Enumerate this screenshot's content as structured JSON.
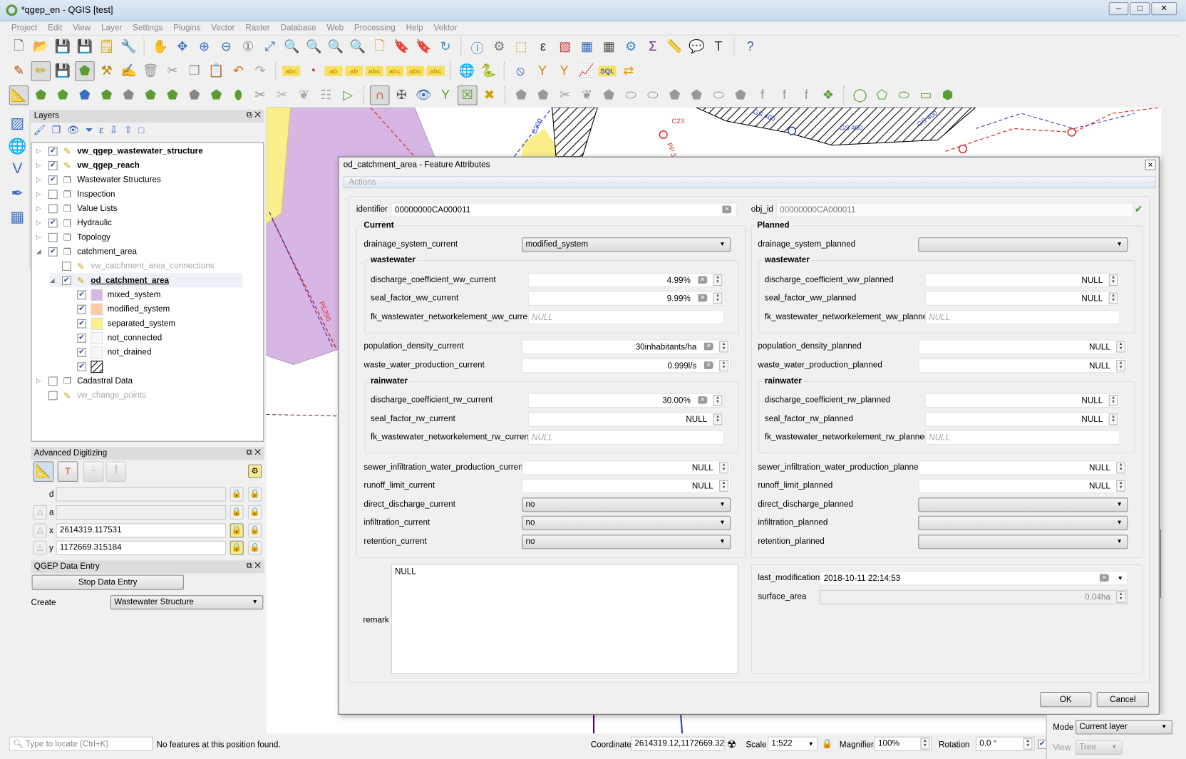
{
  "window": {
    "title": "*qgep_en - QGIS [test]",
    "controls": [
      "–",
      "□",
      "✕"
    ]
  },
  "menu": [
    "Project",
    "Edit",
    "View",
    "Layer",
    "Settings",
    "Plugins",
    "Vector",
    "Raster",
    "Database",
    "Web",
    "Processing",
    "Help",
    "Vektor"
  ],
  "toolbars": {
    "row1": [
      [
        "new-project-icon",
        "🗋",
        "#555"
      ],
      [
        "open-project-icon",
        "📂",
        "#e0b030"
      ],
      [
        "save-project-icon",
        "💾",
        "#46628a"
      ],
      [
        "save-as-icon",
        "💾",
        "#46628a"
      ],
      [
        "new-print-layout-icon",
        "🗒",
        "#c9a000"
      ],
      [
        "layout-manager-icon",
        "🔧",
        "#777"
      ],
      "|",
      [
        "pan-icon",
        "✋",
        "#333"
      ],
      [
        "pan-to-selection-icon",
        "✥",
        "#3a6fc0"
      ],
      [
        "zoom-in-icon",
        "⊕",
        "#3a6fc0"
      ],
      [
        "zoom-out-icon",
        "⊖",
        "#3a6fc0"
      ],
      [
        "zoom-native-icon",
        "①",
        "#777"
      ],
      [
        "zoom-full-icon",
        "⤢",
        "#3a6fc0"
      ],
      [
        "zoom-selection-icon",
        "🔍",
        "#c9a000"
      ],
      [
        "zoom-layer-icon",
        "🔍",
        "#777"
      ],
      [
        "zoom-last-icon",
        "🔍",
        "#3a6fc0"
      ],
      [
        "zoom-next-icon",
        "🔍",
        "#aaa"
      ],
      [
        "new-bookmark-icon",
        "🗋",
        "#c9a000"
      ],
      [
        "show-bookmarks-icon",
        "🔖",
        "#c9a000"
      ],
      [
        "temporal-icon",
        "🔖",
        "#777"
      ],
      [
        "refresh-icon",
        "↻",
        "#3a8ad0"
      ],
      "|",
      [
        "identify-icon",
        "ⓘ",
        "#3a6fc0"
      ],
      [
        "action-icon",
        "⚙",
        "#777"
      ],
      [
        "select-icon",
        "⬚",
        "#c9a000"
      ],
      [
        "select-value-icon",
        "ε",
        "#333"
      ],
      [
        "deselect-icon",
        "▧",
        "#d04040"
      ],
      [
        "attribute-table-icon",
        "▦",
        "#3a6fc0"
      ],
      [
        "field-calc-icon",
        "▦",
        "#555"
      ],
      [
        "toolbox-icon",
        "⚙",
        "#3a8ad0"
      ],
      [
        "statistics-icon",
        "Σ",
        "#6a2aa0"
      ],
      [
        "measure-icon",
        "📏",
        "#555"
      ],
      [
        "map-tips-icon",
        "💬",
        "#e0c000"
      ],
      [
        "text-annotation-icon",
        "T",
        "#333"
      ],
      "|",
      [
        "help-icon",
        "?",
        "#3a5fa0"
      ]
    ],
    "row2": [
      [
        "current-edits-icon",
        "✎",
        "#c04000"
      ],
      [
        "toggle-editing-icon",
        "✏",
        "#d0a000"
      ],
      [
        "save-edits-icon",
        "💾",
        "#46628a"
      ],
      [
        "add-feature-icon",
        "⬟",
        "#5a9e33"
      ],
      [
        "vertex-tool-icon",
        "⚒",
        "#c08000"
      ],
      [
        "modify-attributes-icon",
        "✍",
        "#999"
      ],
      [
        "delete-selected-icon",
        "🗑",
        "#999"
      ],
      [
        "cut-icon",
        "✂",
        "#999"
      ],
      [
        "copy-icon",
        "❐",
        "#999"
      ],
      [
        "paste-icon",
        "📋",
        "#999"
      ],
      [
        "undo-icon",
        "↶",
        "#e07020"
      ],
      [
        "redo-icon",
        "↷",
        "#aaa"
      ],
      "|",
      [
        "label-icon",
        "abc",
        "#c9a000"
      ],
      [
        "diagram-icon",
        "◔",
        "#d03030"
      ],
      [
        "pin-label-icon",
        "ab",
        "#c9a000"
      ],
      [
        "highlight-pin-icon",
        "ab",
        "#c9a000"
      ],
      [
        "show-hide-label-icon",
        "abc",
        "#c9a000"
      ],
      [
        "move-label-icon",
        "abc",
        "#c9a000"
      ],
      [
        "rotate-label-icon",
        "abc",
        "#c9a000"
      ],
      [
        "change-label-icon",
        "abc",
        "#c9a000"
      ],
      "|",
      [
        "qgep-globe-icon",
        "🌐",
        "#345"
      ],
      [
        "python-icon",
        "🐍",
        "#3a6fc0"
      ],
      "|",
      [
        "qgep-connect-icon",
        "⦸",
        "#3a6fc0"
      ],
      [
        "upstream-icon",
        "Y",
        "#e08000"
      ],
      [
        "downstream-icon",
        "Y",
        "#e08000"
      ],
      [
        "profile-icon",
        "📈",
        "#3a5fa0"
      ],
      [
        "sql-icon",
        "SQL",
        "#3a5fa0"
      ],
      [
        "wizard-icon",
        "⇄",
        "#e0a000"
      ]
    ],
    "row3": [
      [
        "advanced-digitizing-icon",
        "📐",
        "#e07020"
      ],
      [
        "add-ring-icon",
        "⬟",
        "#5a9e33"
      ],
      [
        "rotate-feature-icon",
        "⬟",
        "#5a9e33"
      ],
      [
        "reshape-icon",
        "⬟",
        "#3a6fc0"
      ],
      [
        "add-part-icon",
        "⬟",
        "#5a9e33"
      ],
      [
        "fill-ring-icon",
        "⬟",
        "#888"
      ],
      [
        "add-ring2-icon",
        "⬟",
        "#5a9e33"
      ],
      [
        "delete-ring-icon",
        "⬟",
        "#5a9e33"
      ],
      [
        "delete-part-icon",
        "⬟",
        "#888"
      ],
      [
        "reshape-features-icon",
        "⬟",
        "#5a9e33"
      ],
      [
        "offset-curve-icon",
        "⬮",
        "#5a9e33"
      ],
      [
        "split-features-icon",
        "✂",
        "#888"
      ],
      [
        "split-parts-icon",
        "✂",
        "#aaa"
      ],
      [
        "merge-selected-icon",
        "❦",
        "#aaa"
      ],
      [
        "merge-attributes-icon",
        "☷",
        "#aaa"
      ],
      [
        "rotate-symbols-icon",
        "▷",
        "#5a9e33"
      ],
      "|",
      [
        "snapping-icon",
        "∩",
        "#d02020"
      ],
      [
        "topological-editing-icon",
        "✠",
        "#666"
      ],
      [
        "avoid-intersections-icon",
        "👁",
        "#3a6fc0"
      ],
      [
        "tracing-icon",
        "Y",
        "#5a9e33"
      ],
      [
        "snap-intersections-icon",
        "☒",
        "#5a9e33"
      ],
      [
        "snap-segment-icon",
        "✖",
        "#d0a000"
      ],
      "|",
      [
        "simplify-icon",
        "⬟",
        "#999"
      ],
      [
        "add-ring3-icon",
        "⬟",
        "#999"
      ],
      [
        "split-icon",
        "✂",
        "#999"
      ],
      [
        "merge-icon",
        "❦",
        "#999"
      ],
      [
        "fill-icon",
        "⬟",
        "#999"
      ],
      [
        "delete-icon",
        "⬭",
        "#999"
      ],
      [
        "reverse-icon",
        "⬭",
        "#999"
      ],
      [
        "offset-icon",
        "⬟",
        "#999"
      ],
      [
        "trim-icon",
        "⬟",
        "#999"
      ],
      [
        "add-curve-icon",
        "⬭",
        "#999"
      ],
      [
        "shape-digitize-icon",
        "⬟",
        "#999"
      ],
      [
        "ff-icon",
        "f",
        "#999"
      ],
      [
        "fd-icon",
        "f",
        "#999"
      ],
      [
        "fz-icon",
        "f",
        "#999"
      ],
      [
        "node-icon",
        "❖",
        "#5a9e33"
      ],
      "|",
      [
        "circle-icon",
        "◯",
        "#5a9e33"
      ],
      [
        "polygon-icon",
        "⬠",
        "#5a9e33"
      ],
      [
        "ellipse-icon",
        "⬭",
        "#5a9e33"
      ],
      [
        "rectangle-icon",
        "▭",
        "#5a9e33"
      ],
      [
        "regular-polygon-icon",
        "⬢",
        "#5a9e33"
      ]
    ]
  },
  "layers_panel": {
    "title": "Layers",
    "toolbar": [
      [
        "style-icon",
        "🖌"
      ],
      [
        "add-group-icon",
        "❐"
      ],
      [
        "visibility-icon",
        "👁"
      ],
      [
        "filter-icon",
        "⏷"
      ],
      [
        "expression-filter-icon",
        "ε"
      ],
      [
        "expand-all-icon",
        "⇩"
      ],
      [
        "collapse-all-icon",
        "⇧"
      ],
      [
        "remove-layer-icon",
        "□"
      ]
    ],
    "items": [
      {
        "label": "vw_qgep_wastewater_structure",
        "checked": true,
        "bold": true,
        "icon": "pencil-icon"
      },
      {
        "label": "vw_qgep_reach",
        "checked": true,
        "bold": true,
        "icon": "pencil-icon"
      },
      {
        "label": "Wastewater Structures",
        "checked": true,
        "icon": "group-icon"
      },
      {
        "label": "Inspection",
        "checked": false,
        "icon": "group-icon"
      },
      {
        "label": "Value Lists",
        "checked": false,
        "icon": "group-icon"
      },
      {
        "label": "Hydraulic",
        "checked": true,
        "icon": "group-icon"
      },
      {
        "label": "Topology",
        "checked": false,
        "icon": "group-icon"
      },
      {
        "label": "catchment_area",
        "checked": true,
        "icon": "group-icon"
      },
      {
        "label": "vw_catchment_area_connections",
        "checked": false,
        "icon": "pencil-icon"
      },
      {
        "label": "od_catchment_area",
        "checked": true,
        "icon": "pencil-icon"
      },
      {
        "label": "Cadastral Data",
        "checked": false,
        "icon": "group-icon"
      },
      {
        "label": "vw_change_points",
        "checked": false,
        "icon": "pencil-icon"
      }
    ],
    "legend": [
      {
        "label": "mixed_system",
        "color": "#d7b6e4"
      },
      {
        "label": "modified_system",
        "color": "#fbcaa4"
      },
      {
        "label": "separated_system",
        "color": "#fbef8c"
      },
      {
        "label": "not_connected",
        "color": "#f7f7f9"
      },
      {
        "label": "not_drained",
        "color": "#f7f7f9"
      },
      {
        "label": "",
        "color": "hatched"
      }
    ]
  },
  "adv_digitizing": {
    "title": "Advanced Digitizing",
    "d_label": "d",
    "a_label": "a",
    "x_label": "x",
    "y_label": "y",
    "x_value": "2614319.117531",
    "y_value": "1172669.315184"
  },
  "qgep_entry": {
    "title": "QGEP Data Entry",
    "stop_button": "Stop Data Entry",
    "create_label": "Create",
    "create_value": "Wastewater Structure"
  },
  "dialog": {
    "title": "od_catchment_area - Feature Attributes",
    "actions": "Actions",
    "identifier": {
      "label": "identifier",
      "value": "00000000CA000011"
    },
    "obj_id": {
      "label": "obj_id",
      "value": "00000000CA000011"
    },
    "current": {
      "title": "Current",
      "drainage_system": {
        "label": "drainage_system_current",
        "value": "modified_system"
      },
      "ww_title": "wastewater",
      "discharge_ww": {
        "label": "discharge_coefficient_ww_current",
        "value": "4.99%"
      },
      "seal_ww": {
        "label": "seal_factor_ww_current",
        "value": "9.99%"
      },
      "fk_ww": {
        "label": "fk_wastewater_networkelement_ww_current",
        "value": "NULL"
      },
      "population": {
        "label": "population_density_current",
        "value": "30inhabitants/ha"
      },
      "waste_water": {
        "label": "waste_water_production_current",
        "value": "0.999l/s"
      },
      "rw_title": "rainwater",
      "discharge_rw": {
        "label": "discharge_coefficient_rw_current",
        "value": "30.00%"
      },
      "seal_rw": {
        "label": "seal_factor_rw_current",
        "value": "NULL"
      },
      "fk_rw": {
        "label": "fk_wastewater_networkelement_rw_current",
        "value": "NULL"
      },
      "sewer": {
        "label": "sewer_infiltration_water_production_current",
        "value": "NULL"
      },
      "runoff": {
        "label": "runoff_limit_current",
        "value": "NULL"
      },
      "direct": {
        "label": "direct_discharge_current",
        "value": "no"
      },
      "infiltration": {
        "label": "infiltration_current",
        "value": "no"
      },
      "retention": {
        "label": "retention_current",
        "value": "no"
      }
    },
    "planned": {
      "title": "Planned",
      "drainage_system": {
        "label": "drainage_system_planned",
        "value": ""
      },
      "ww_title": "wastewater",
      "discharge_ww": {
        "label": "discharge_coefficient_ww_planned",
        "value": "NULL"
      },
      "seal_ww": {
        "label": "seal_factor_ww_planned",
        "value": "NULL"
      },
      "fk_ww": {
        "label": "fk_wastewater_networkelement_ww_planned",
        "value": "NULL"
      },
      "population": {
        "label": "population_density_planned",
        "value": "NULL"
      },
      "waste_water": {
        "label": "waste_water_production_planned",
        "value": "NULL"
      },
      "rw_title": "rainwater",
      "discharge_rw": {
        "label": "discharge_coefficient_rw_planned",
        "value": "NULL"
      },
      "seal_rw": {
        "label": "seal_factor_rw_planned",
        "value": "NULL"
      },
      "fk_rw": {
        "label": "fk_wastewater_networkelement_rw_planned",
        "value": "NULL"
      },
      "sewer": {
        "label": "sewer_infiltration_water_production_planned",
        "value": "NULL"
      },
      "runoff": {
        "label": "runoff_limit_planned",
        "value": "NULL"
      },
      "direct": {
        "label": "direct_discharge_planned",
        "value": ""
      },
      "infiltration": {
        "label": "infiltration_planned",
        "value": ""
      },
      "retention": {
        "label": "retention_planned",
        "value": ""
      }
    },
    "remark": {
      "label": "remark",
      "value": "NULL"
    },
    "last_modification": {
      "label": "last_modification",
      "value": "2018-10-11 22:14:53"
    },
    "surface_area": {
      "label": "surface_area",
      "value": "0.04ha"
    },
    "ok": "OK",
    "cancel": "Cancel"
  },
  "map_labels": [
    "C23",
    "PP 3",
    "PE250",
    "GS 400",
    "GS 400",
    "GS 400",
    "C300"
  ],
  "status": {
    "locate_placeholder": "Type to locate (Ctrl+K)",
    "message": "No features at this position found.",
    "coordinate_label": "Coordinate",
    "coordinate": "2614319.12,1172669.32",
    "scale_label": "Scale",
    "scale": "1:522",
    "magnifier_label": "Magnifier",
    "magnifier": "100%",
    "rotation_label": "Rotation",
    "rotation": "0.0 °"
  },
  "identify_panel": {
    "mode_label": "Mode",
    "mode": "Current layer",
    "view_label": "View",
    "view": "Tree"
  }
}
